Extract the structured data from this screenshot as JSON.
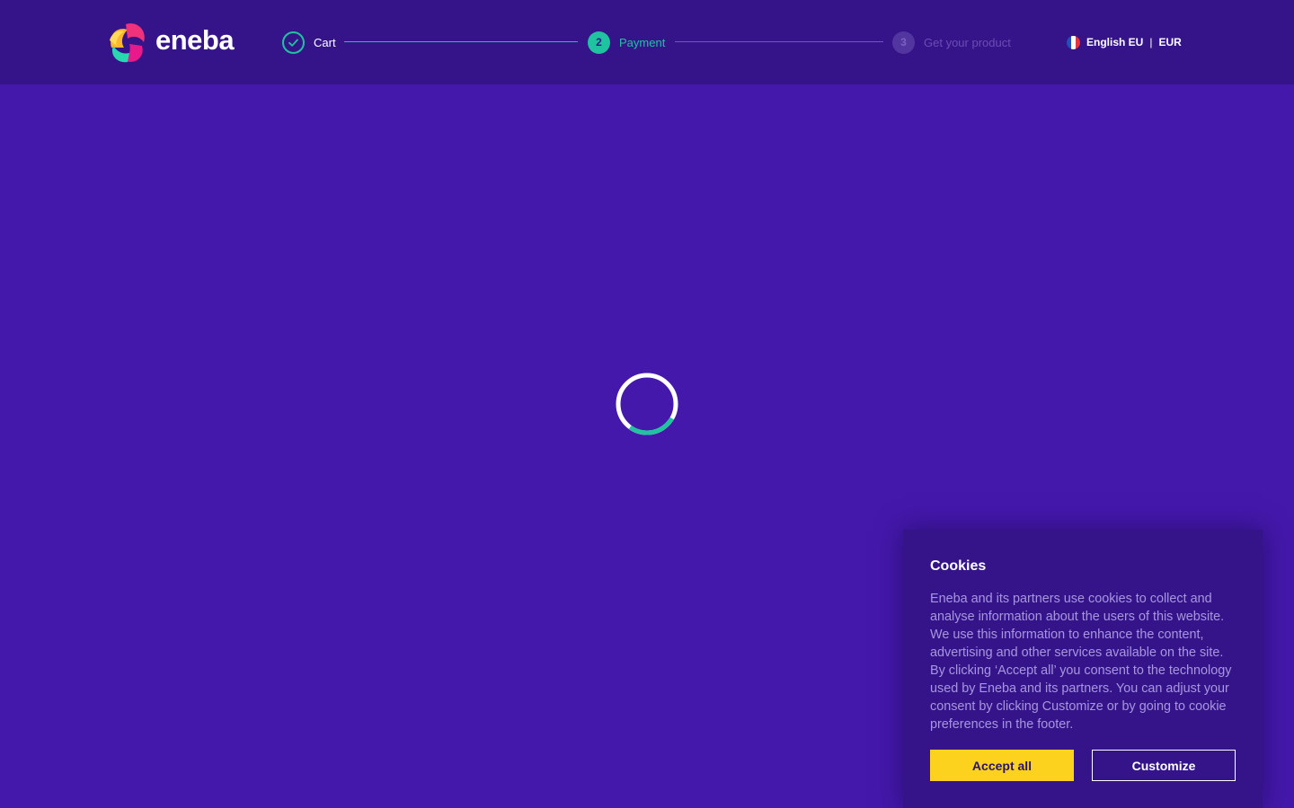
{
  "header": {
    "logo_text": "eneba",
    "steps": [
      {
        "label": "Cart",
        "state": "done",
        "icon": "check-icon"
      },
      {
        "number": "2",
        "label": "Payment",
        "state": "active"
      },
      {
        "number": "3",
        "label": "Get your product",
        "state": "inactive"
      }
    ],
    "locale": {
      "flag_icon": "france-flag-icon",
      "language": "English EU",
      "separator": "|",
      "currency": "EUR"
    }
  },
  "main": {
    "loading_indicator": "spinner-icon"
  },
  "cookie_banner": {
    "title": "Cookies",
    "text": "Eneba and its partners use cookies to collect and analyse information about the users of this website. We use this information to enhance the content, advertising and other services available on the site. By clicking ‘Accept all’ you consent to the technology used by Eneba and its partners. You can adjust your consent by clicking Customize or by going to cookie preferences in the footer.",
    "accept_label": "Accept all",
    "customize_label": "Customize"
  },
  "colors": {
    "page_background": "#4418ab",
    "header_background": "#35148a",
    "accent_teal": "#1fc3a0",
    "accept_yellow": "#fcd21e"
  }
}
